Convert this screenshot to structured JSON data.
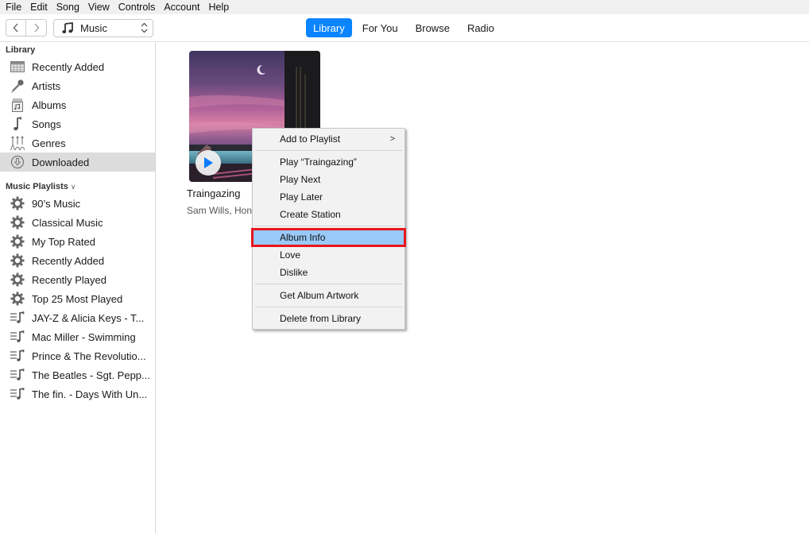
{
  "menubar": [
    "File",
    "Edit",
    "Song",
    "View",
    "Controls",
    "Account",
    "Help"
  ],
  "toolbar": {
    "back_icon": "chevron-left-icon",
    "forward_icon": "chevron-right-icon",
    "source": {
      "icon": "music-note-icon",
      "label": "Music"
    },
    "tabs": [
      {
        "label": "Library",
        "active": true
      },
      {
        "label": "For You",
        "active": false
      },
      {
        "label": "Browse",
        "active": false
      },
      {
        "label": "Radio",
        "active": false
      }
    ]
  },
  "sidebar": {
    "library_title": "Library",
    "library_items": [
      {
        "label": "Recently Added",
        "icon": "calendar-grid-icon"
      },
      {
        "label": "Artists",
        "icon": "microphone-icon"
      },
      {
        "label": "Albums",
        "icon": "album-icon"
      },
      {
        "label": "Songs",
        "icon": "music-note-icon"
      },
      {
        "label": "Genres",
        "icon": "guitars-icon"
      },
      {
        "label": "Downloaded",
        "icon": "download-circle-icon",
        "selected": true
      }
    ],
    "playlists_title": "Music Playlists",
    "playlist_items": [
      {
        "label": "90’s Music",
        "icon": "gear-icon"
      },
      {
        "label": "Classical Music",
        "icon": "gear-icon"
      },
      {
        "label": "My Top Rated",
        "icon": "gear-icon"
      },
      {
        "label": "Recently Added",
        "icon": "gear-icon"
      },
      {
        "label": "Recently Played",
        "icon": "gear-icon"
      },
      {
        "label": "Top 25 Most Played",
        "icon": "gear-icon"
      },
      {
        "label": "JAY-Z & Alicia Keys - T...",
        "icon": "playlist-icon"
      },
      {
        "label": "Mac Miller - Swimming",
        "icon": "playlist-icon"
      },
      {
        "label": "Prince & The Revolutio...",
        "icon": "playlist-icon"
      },
      {
        "label": "The Beatles - Sgt. Pepp...",
        "icon": "playlist-icon"
      },
      {
        "label": "The fin. - Days With Un...",
        "icon": "playlist-icon"
      }
    ]
  },
  "album": {
    "title": "Traingazing",
    "artist": "Sam Wills, Hone",
    "play_icon": "play-icon",
    "colors": {
      "sky_top": "#4d3a6e",
      "sky_pink": "#c96a9a",
      "water": "#5fa7b8",
      "dark": "#1e1a1f"
    }
  },
  "context_menu": {
    "groups": [
      [
        {
          "label": "Add to Playlist",
          "submenu": true
        }
      ],
      [
        {
          "label": "Play “Traingazing”"
        },
        {
          "label": "Play Next"
        },
        {
          "label": "Play Later"
        },
        {
          "label": "Create Station"
        }
      ],
      [
        {
          "label": "Album Info",
          "highlighted": true
        },
        {
          "label": "Love"
        },
        {
          "label": "Dislike"
        }
      ],
      [
        {
          "label": "Get Album Artwork"
        }
      ],
      [
        {
          "label": "Delete from Library"
        }
      ]
    ],
    "submenu_arrow": ">"
  },
  "colors": {
    "accent": "#0a84ff",
    "highlight": "#99c9f7",
    "annotation_red": "#e8161c",
    "selected_row": "#dcdcdc"
  }
}
